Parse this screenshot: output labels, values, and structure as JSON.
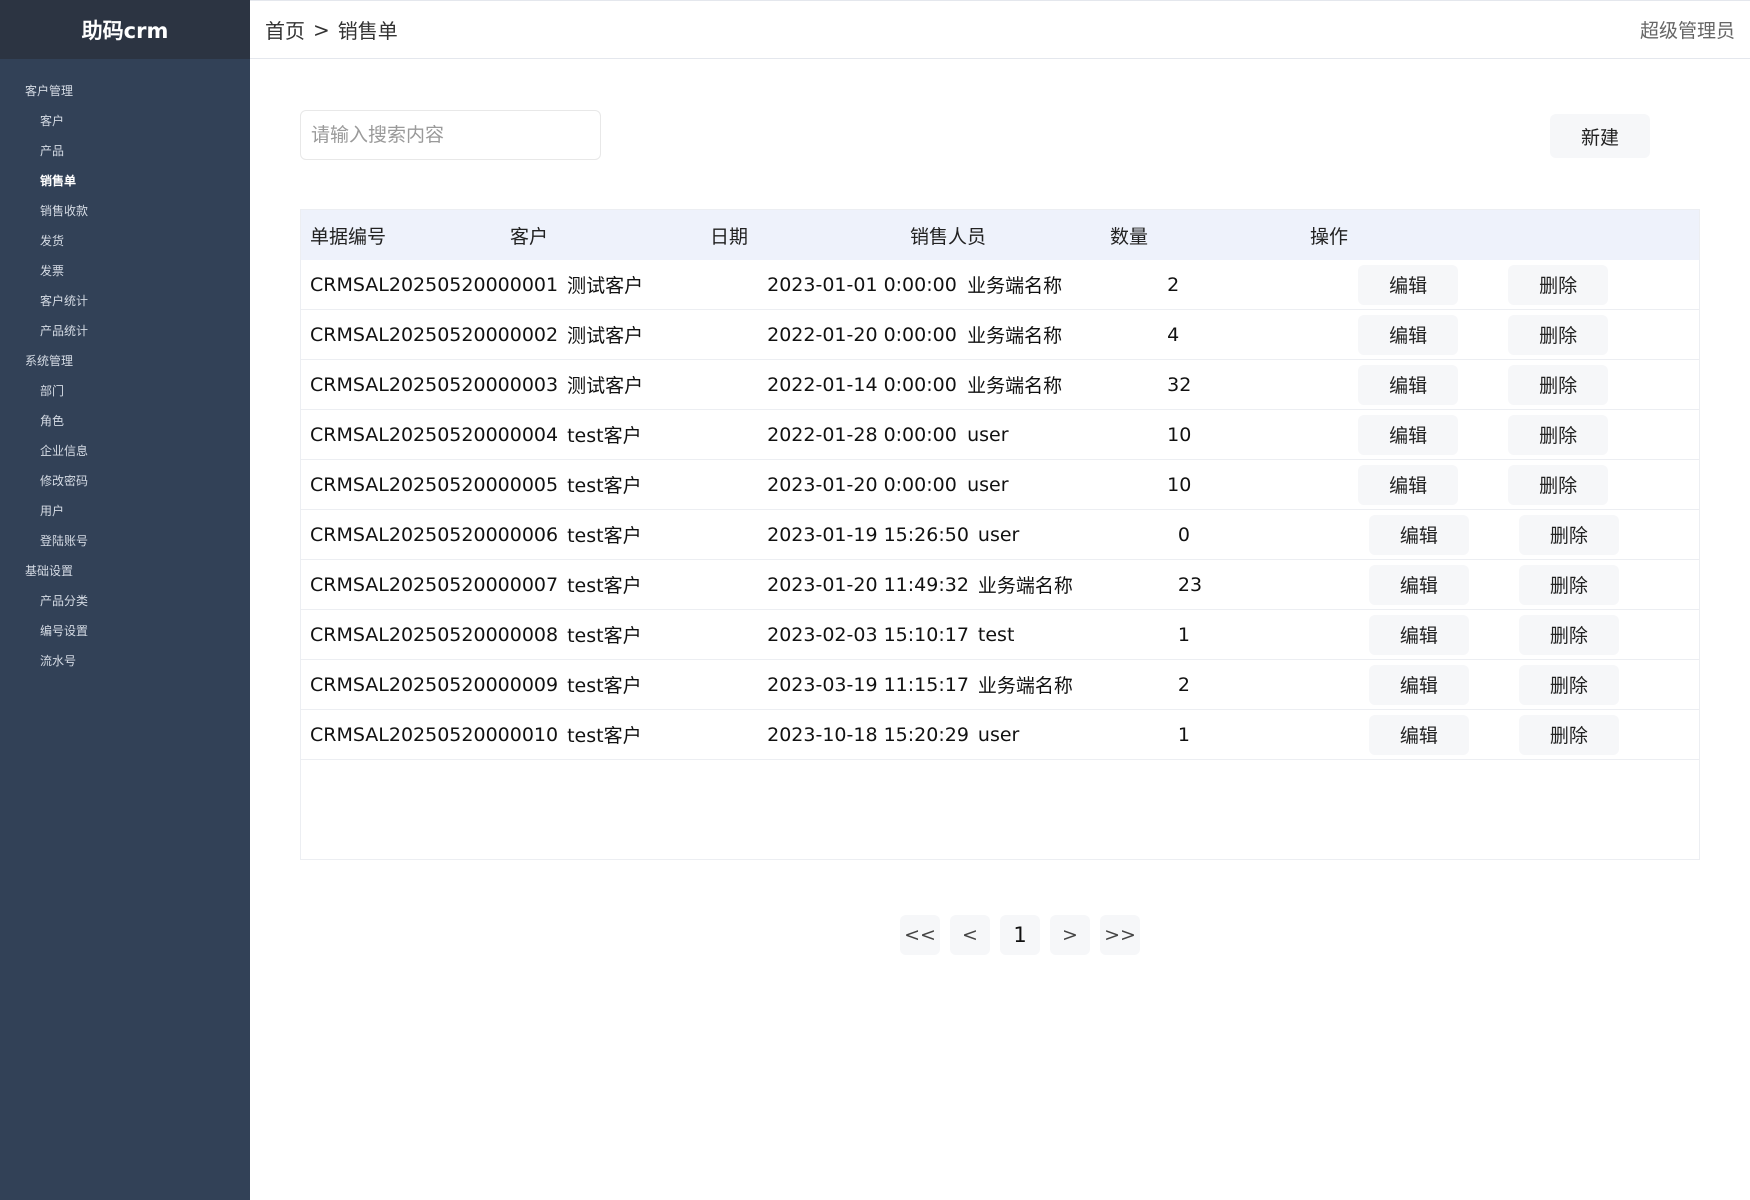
{
  "app": {
    "title": "助码crm"
  },
  "sidebar": {
    "items": [
      {
        "label": "客户管理",
        "level": 1,
        "active": false
      },
      {
        "label": "客户",
        "level": 2,
        "active": false
      },
      {
        "label": "产品",
        "level": 2,
        "active": false
      },
      {
        "label": "销售单",
        "level": 2,
        "active": true
      },
      {
        "label": "销售收款",
        "level": 2,
        "active": false
      },
      {
        "label": "发货",
        "level": 2,
        "active": false
      },
      {
        "label": "发票",
        "level": 2,
        "active": false
      },
      {
        "label": "客户统计",
        "level": 2,
        "active": false
      },
      {
        "label": "产品统计",
        "level": 2,
        "active": false
      },
      {
        "label": "系统管理",
        "level": 1,
        "active": false
      },
      {
        "label": "部门",
        "level": 2,
        "active": false
      },
      {
        "label": "角色",
        "level": 2,
        "active": false
      },
      {
        "label": "企业信息",
        "level": 2,
        "active": false
      },
      {
        "label": "修改密码",
        "level": 2,
        "active": false
      },
      {
        "label": "用户",
        "level": 2,
        "active": false
      },
      {
        "label": "登陆账号",
        "level": 2,
        "active": false
      },
      {
        "label": "基础设置",
        "level": 1,
        "active": false
      },
      {
        "label": "产品分类",
        "level": 2,
        "active": false
      },
      {
        "label": "编号设置",
        "level": 2,
        "active": false
      },
      {
        "label": "流水号",
        "level": 2,
        "active": false
      }
    ]
  },
  "header": {
    "breadcrumb": [
      "首页",
      ">",
      "销售单"
    ],
    "user": "超级管理员"
  },
  "search": {
    "placeholder": "请输入搜索内容",
    "value": ""
  },
  "toolbar": {
    "new_label": "新建"
  },
  "table": {
    "columns": [
      "单据编号",
      "客户",
      "日期",
      "销售人员",
      "数量",
      "操作"
    ],
    "edit_label": "编辑",
    "delete_label": "删除",
    "rows": [
      {
        "code": "CRMSAL20250520000001",
        "customer": "测试客户",
        "date": "2023-01-01 0:00:00",
        "sales": "业务端名称",
        "qty": "2"
      },
      {
        "code": "CRMSAL20250520000002",
        "customer": "测试客户",
        "date": "2022-01-20 0:00:00",
        "sales": "业务端名称",
        "qty": "4"
      },
      {
        "code": "CRMSAL20250520000003",
        "customer": "测试客户",
        "date": "2022-01-14 0:00:00",
        "sales": "业务端名称",
        "qty": "32"
      },
      {
        "code": "CRMSAL20250520000004",
        "customer": "test客户",
        "date": "2022-01-28 0:00:00",
        "sales": "user",
        "qty": "10"
      },
      {
        "code": "CRMSAL20250520000005",
        "customer": "test客户",
        "date": "2023-01-20 0:00:00",
        "sales": "user",
        "qty": "10"
      },
      {
        "code": "CRMSAL20250520000006",
        "customer": "test客户",
        "date": "2023-01-19 15:26:50",
        "sales": "user",
        "qty": "0"
      },
      {
        "code": "CRMSAL20250520000007",
        "customer": "test客户",
        "date": "2023-01-20 11:49:32",
        "sales": "业务端名称",
        "qty": "23"
      },
      {
        "code": "CRMSAL20250520000008",
        "customer": "test客户",
        "date": "2023-02-03 15:10:17",
        "sales": "test",
        "qty": "1"
      },
      {
        "code": "CRMSAL20250520000009",
        "customer": "test客户",
        "date": "2023-03-19 11:15:17",
        "sales": "业务端名称",
        "qty": "2"
      },
      {
        "code": "CRMSAL20250520000010",
        "customer": "test客户",
        "date": "2023-10-18 15:20:29",
        "sales": "user",
        "qty": "1"
      }
    ]
  },
  "pagination": {
    "first": "<<",
    "prev": "<",
    "current": "1",
    "next": ">",
    "last": ">>"
  }
}
